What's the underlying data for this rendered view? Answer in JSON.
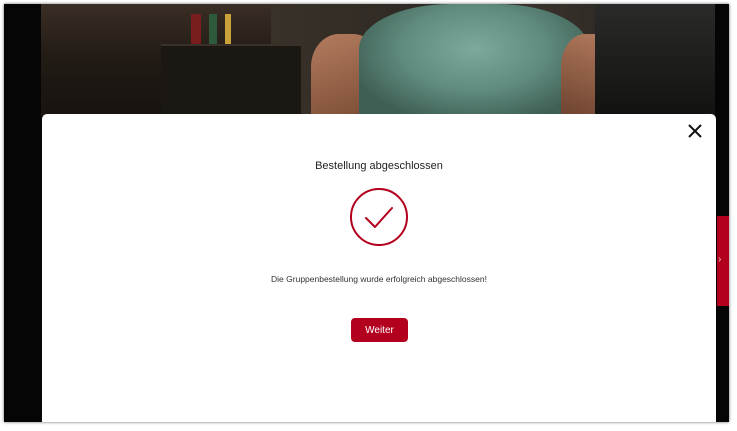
{
  "modal": {
    "title": "Bestellung abgeschlossen",
    "message": "Die Gruppenbestellung wurde erfolgreich abgeschlossen!",
    "continue_label": "Weiter",
    "close_icon": "close-icon",
    "success_icon": "checkmark-circle-icon"
  },
  "side_tab": {
    "icon": "chevron-right-icon"
  },
  "colors": {
    "accent": "#b3001e",
    "modal_background": "#ffffff",
    "overlay": "#0b0b0b"
  }
}
